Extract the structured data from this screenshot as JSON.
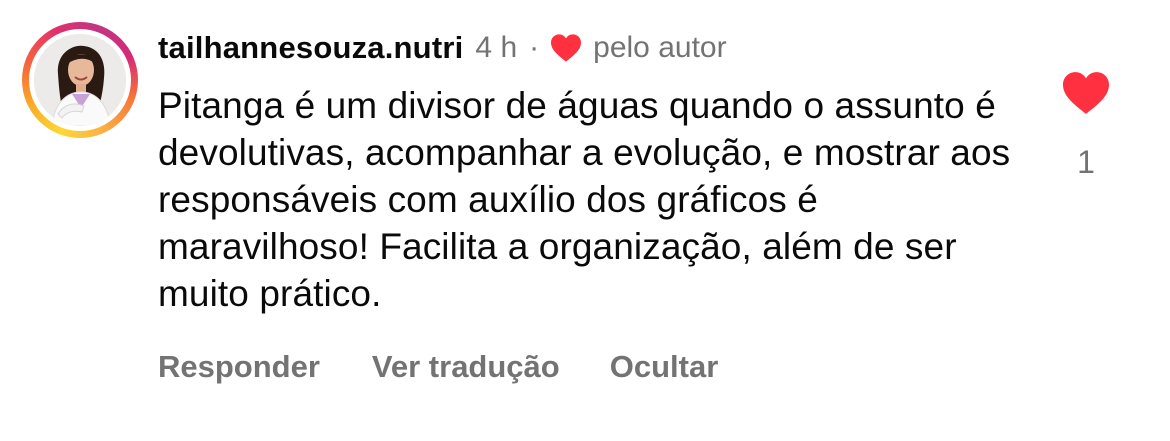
{
  "comment": {
    "username": "tailhannesouza.nutri",
    "time": "4 h",
    "separator": "·",
    "liked_by_author_label": "pelo autor",
    "text": "Pitanga é um divisor de águas quando o assunto é devolutivas, acompanhar a evolução, e mostrar aos responsáveis com auxílio dos gráficos é maravilhoso! Facilita a organização, além de ser muito prático.",
    "like_count": "1"
  },
  "actions": {
    "reply": "Responder",
    "translate": "Ver tradução",
    "hide": "Ocultar"
  },
  "icons": {
    "author_heart": "heart-icon",
    "like_heart": "heart-icon"
  },
  "colors": {
    "heart": "#ff3040",
    "secondary_text": "#737373",
    "primary_text": "#0a0a0a"
  }
}
